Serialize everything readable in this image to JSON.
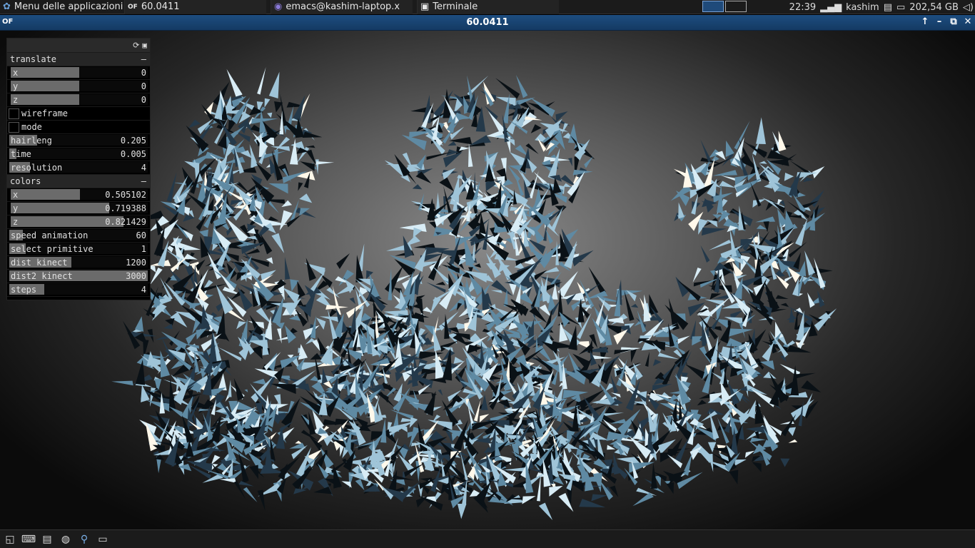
{
  "top_panel": {
    "app_menu": "Menu delle applicazioni",
    "tasks": [
      {
        "label": "60.0411",
        "icon": "of-icon"
      },
      {
        "label": "emacs@kashim-laptop.x",
        "icon": "emacs-icon"
      },
      {
        "label": "Terminale",
        "icon": "terminal-icon"
      }
    ],
    "clock": "22:39",
    "user": "kashim",
    "disk": "202,54 GB"
  },
  "window": {
    "title": "60.0411",
    "icon_text": "OF"
  },
  "gui": {
    "translate": {
      "title": "translate",
      "collapse": "–",
      "x": {
        "label": "x",
        "value": "0",
        "fill": 0.5
      },
      "y": {
        "label": "y",
        "value": "0",
        "fill": 0.5
      },
      "z": {
        "label": "z",
        "value": "0",
        "fill": 0.5
      }
    },
    "wireframe": {
      "label": "wireframe",
      "checked": false
    },
    "mode": {
      "label": "mode",
      "checked": false
    },
    "hairleng": {
      "label": "hairleng",
      "value": "0.205",
      "fill": 0.2
    },
    "time": {
      "label": "time",
      "value": "0.005",
      "fill": 0.05
    },
    "resolution": {
      "label": "resolution",
      "value": "4",
      "fill": 0.15
    },
    "colors": {
      "title": "colors",
      "collapse": "–",
      "x": {
        "label": "x",
        "value": "0.505102",
        "fill": 0.505
      },
      "y": {
        "label": "y",
        "value": "0.719388",
        "fill": 0.719
      },
      "z": {
        "label": "z",
        "value": "0.821429",
        "fill": 0.821
      }
    },
    "speed_animation": {
      "label": "speed animation",
      "value": "60",
      "fill": 0.1
    },
    "select_primitive": {
      "label": "select primitive",
      "value": "1",
      "fill": 0.12
    },
    "dist_kinect": {
      "label": "dist kinect",
      "value": "1200",
      "fill": 0.45
    },
    "dist2_kinect": {
      "label": "dist2 kinect",
      "value": "3000",
      "fill": 1.0
    },
    "steps": {
      "label": "steps",
      "value": "4",
      "fill": 0.25
    }
  },
  "colors": {
    "titlebar": "#1d4d80",
    "fur": "#9fc4d8"
  }
}
